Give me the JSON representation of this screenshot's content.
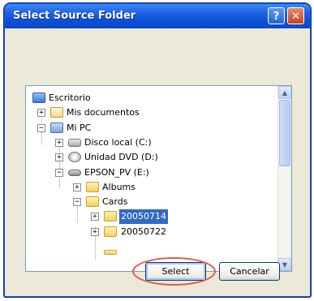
{
  "window": {
    "title": "Select Source Folder"
  },
  "titlebar": {
    "help_label": "?",
    "close_label": "✕"
  },
  "tree": {
    "items": [
      {
        "label": "Escritorio"
      },
      {
        "label": "Mis documentos"
      },
      {
        "label": "Mi PC"
      },
      {
        "label": "Disco local (C:)"
      },
      {
        "label": "Unidad DVD (D:)"
      },
      {
        "label": "EPSON_PV (E:)"
      },
      {
        "label": "Albums"
      },
      {
        "label": "Cards"
      },
      {
        "label": "20050714",
        "selected": true
      },
      {
        "label": "20050722"
      }
    ]
  },
  "buttons": {
    "select_label": "Select",
    "cancel_label": "Cancelar"
  },
  "scrollbar": {
    "up": "▲",
    "down": "▼"
  },
  "colors": {
    "selection": "#316ac5",
    "annotation_ring": "#e25743",
    "titlebar": "#0b4fd6"
  }
}
